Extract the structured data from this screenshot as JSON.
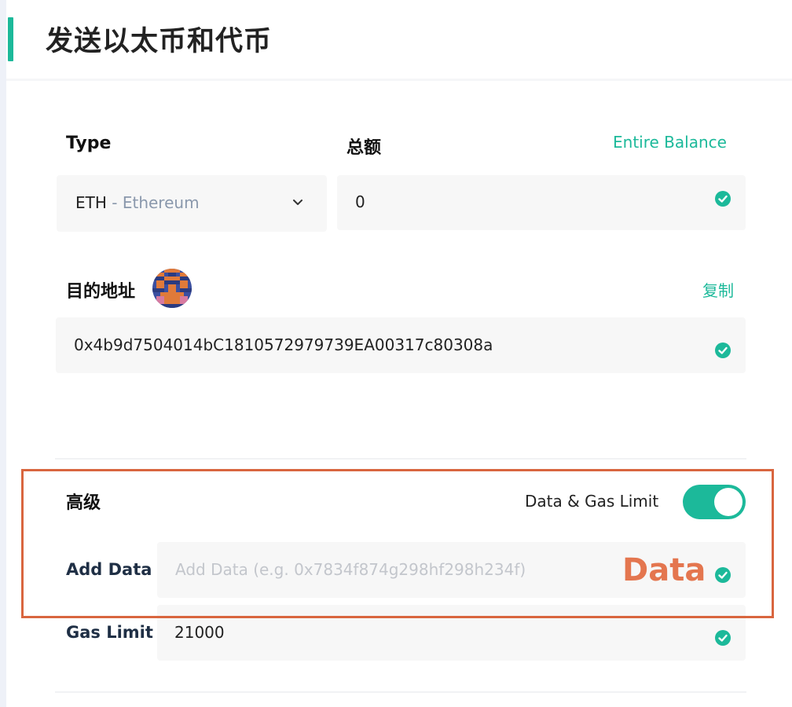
{
  "page": {
    "title": "发送以太币和代币"
  },
  "type_field": {
    "label": "Type",
    "value_symbol": "ETH",
    "value_name": "- Ethereum"
  },
  "amount_field": {
    "label": "总额",
    "entire_balance_link": "Entire Balance",
    "value": "0"
  },
  "destination": {
    "label": "目的地址",
    "copy_link": "复制",
    "value": "0x4b9d7504014bC1810572979739EA00317c80308a"
  },
  "advanced": {
    "label": "高级",
    "toggle_label": "Data & Gas Limit",
    "toggle_on": true,
    "add_data": {
      "label": "Add Data",
      "placeholder": "Add Data (e.g. 0x7834f874g298hf298h234f)"
    },
    "gas_limit": {
      "label": "Gas Limit",
      "value": "21000"
    }
  },
  "annotation": {
    "text": "Data",
    "color": "#e4764f"
  },
  "colors": {
    "accent": "#1cb99a",
    "highlight": "#d9663f"
  },
  "icons": [
    "chevron-down-icon",
    "check-circle-icon",
    "identicon-avatar"
  ]
}
